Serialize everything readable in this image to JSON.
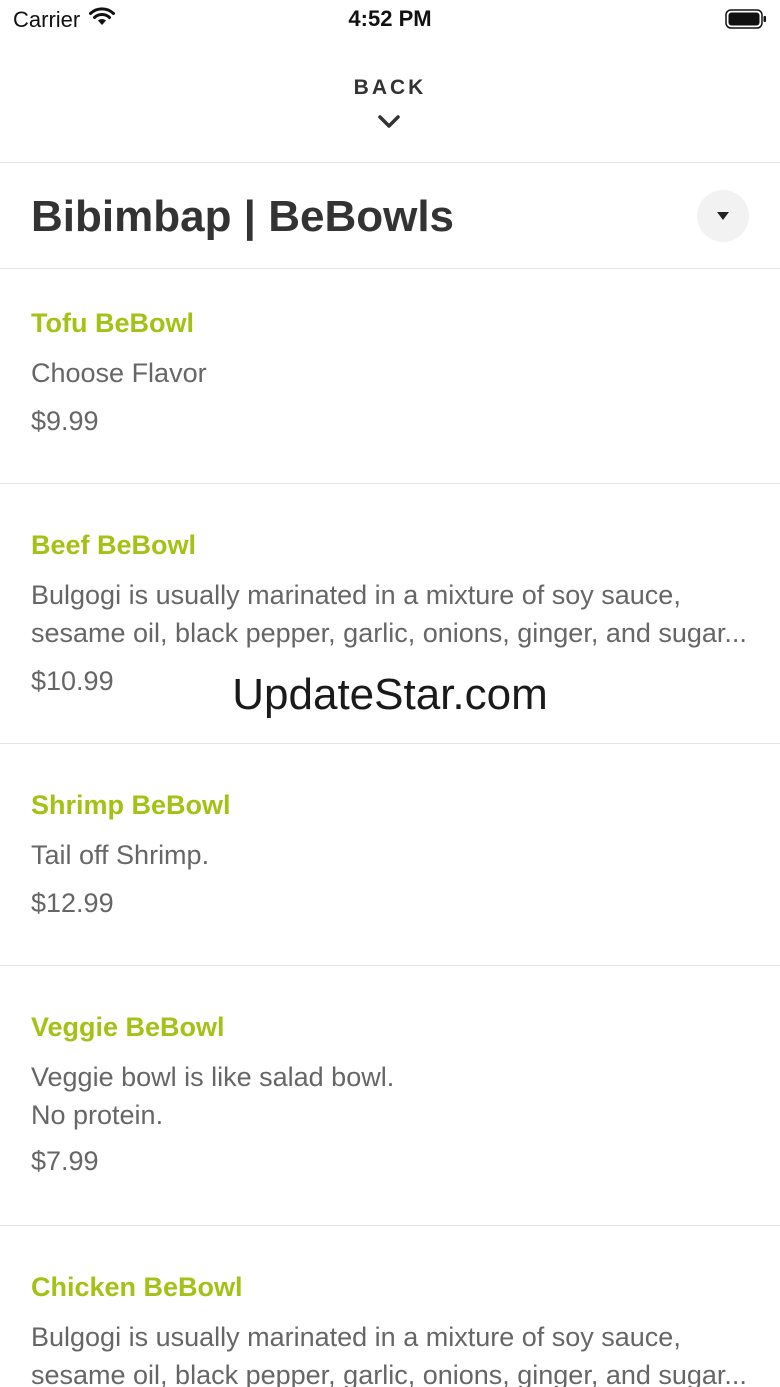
{
  "status": {
    "carrier": "Carrier",
    "time": "4:52 PM"
  },
  "nav": {
    "back_label": "BACK"
  },
  "category": {
    "title": "Bibimbap | BeBowls"
  },
  "items": [
    {
      "name": "Tofu BeBowl",
      "desc_lines": [
        "Choose Flavor"
      ],
      "price": "$9.99"
    },
    {
      "name": "Beef BeBowl",
      "desc_lines": [
        "Bulgogi is usually marinated in a mixture of soy sauce,",
        "sesame oil, black pepper, garlic, onions, ginger, and sugar..."
      ],
      "price": "$10.99"
    },
    {
      "name": "Shrimp BeBowl",
      "desc_lines": [
        "Tail off Shrimp."
      ],
      "price": "$12.99"
    },
    {
      "name": "Veggie BeBowl",
      "desc_lines": [
        "Veggie bowl is like salad bowl.",
        "No protein."
      ],
      "price": "$7.99"
    },
    {
      "name": "Chicken BeBowl",
      "desc_lines": [
        "Bulgogi is usually marinated in a mixture of soy sauce,",
        "sesame oil, black pepper, garlic, onions, ginger, and sugar..."
      ],
      "price": ""
    }
  ],
  "watermark": "UpdateStar.com",
  "colors": {
    "accent": "#a3c215",
    "text": "#333333",
    "muted": "#666666",
    "divider": "#e3e3e3"
  }
}
